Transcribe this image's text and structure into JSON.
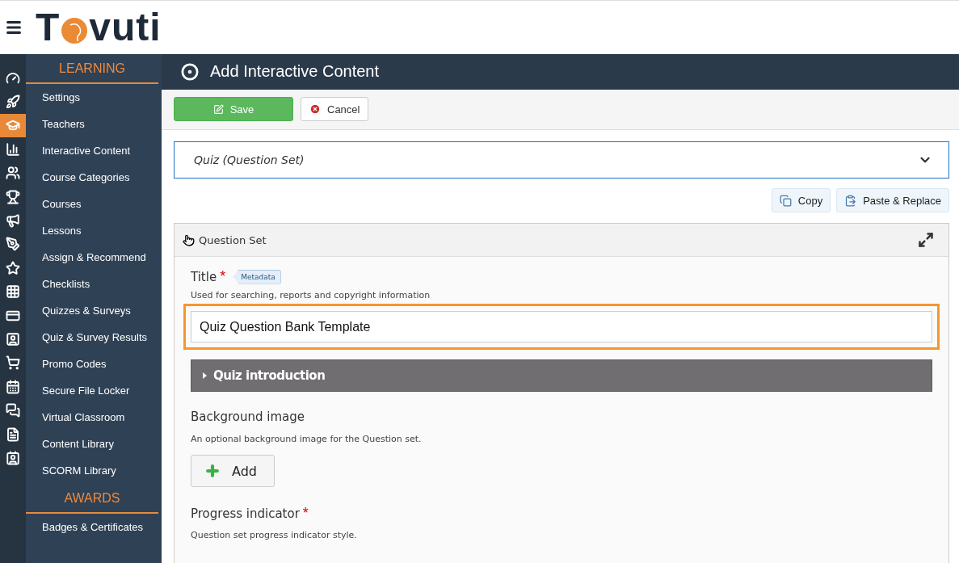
{
  "logo": {
    "start": "T",
    "end": "vuti"
  },
  "icon_rail": [
    {
      "kind": "gauge",
      "selected": false
    },
    {
      "kind": "rocket",
      "selected": false
    },
    {
      "kind": "graduation",
      "selected": true
    },
    {
      "kind": "chart",
      "selected": false
    },
    {
      "kind": "users",
      "selected": false
    },
    {
      "kind": "trophy",
      "selected": false
    },
    {
      "kind": "megaphone",
      "selected": false
    },
    {
      "kind": "pen",
      "selected": false
    },
    {
      "kind": "star",
      "selected": false
    },
    {
      "kind": "grid",
      "selected": false
    },
    {
      "kind": "card",
      "selected": false
    },
    {
      "kind": "contact",
      "selected": false
    },
    {
      "kind": "cart",
      "selected": false
    },
    {
      "kind": "calendar",
      "selected": false
    },
    {
      "kind": "chat",
      "selected": false
    },
    {
      "kind": "document",
      "selected": false
    },
    {
      "kind": "addressbook",
      "selected": false
    }
  ],
  "sidebar": [
    {
      "heading": "LEARNING",
      "items": [
        "Settings",
        "Teachers",
        "Interactive Content",
        "Course Categories",
        "Courses",
        "Lessons",
        "Assign & Recommend",
        "Checklists",
        "Quizzes & Surveys",
        "Quiz & Survey Results",
        "Promo Codes",
        "Secure File Locker",
        "Virtual Classroom",
        "Content Library",
        "SCORM Library"
      ]
    },
    {
      "heading": "AWARDS",
      "items": [
        "Badges & Certificates"
      ]
    }
  ],
  "page_title": "Add Interactive Content",
  "toolbar": {
    "save": "Save",
    "cancel": "Cancel"
  },
  "content_type": {
    "value": "Quiz (Question Set)",
    "expanded": false
  },
  "clipboard": {
    "copy": "Copy",
    "paste": "Paste & Replace"
  },
  "editor": {
    "title": "Question Set",
    "title_field": {
      "label": "Title",
      "required_mark": "*",
      "tag": "Metadata",
      "help": "Used for searching, reports and copyright information",
      "value": "Quiz Question Bank Template",
      "highlighted": true
    },
    "intro_section": {
      "label": "Quiz introduction",
      "expanded": false
    },
    "background": {
      "label": "Background image",
      "help": "An optional background image for the Question set.",
      "button": "Add"
    },
    "progress": {
      "label": "Progress indicator",
      "required_mark": "*",
      "help": "Question set progress indicator style."
    }
  }
}
